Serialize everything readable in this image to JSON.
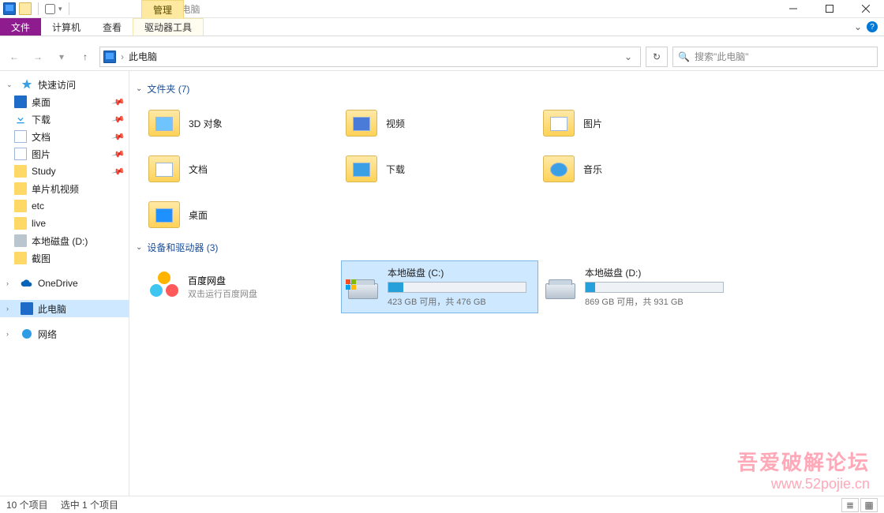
{
  "window": {
    "title": "此电脑"
  },
  "ribbon": {
    "file": "文件",
    "tabs": [
      "计算机",
      "查看"
    ],
    "context_header": "管理",
    "context_tool": "驱动器工具"
  },
  "nav": {
    "breadcrumb": "此电脑",
    "search_placeholder": "搜索\"此电脑\""
  },
  "sidebar": {
    "quick_access": "快速访问",
    "quick_items": [
      {
        "label": "桌面",
        "icon": "desktop",
        "pinned": true
      },
      {
        "label": "下载",
        "icon": "download",
        "pinned": true
      },
      {
        "label": "文档",
        "icon": "doc",
        "pinned": true
      },
      {
        "label": "图片",
        "icon": "pic",
        "pinned": true
      },
      {
        "label": "Study",
        "icon": "folder",
        "pinned": true
      },
      {
        "label": "单片机视频",
        "icon": "folder",
        "pinned": false
      },
      {
        "label": "etc",
        "icon": "folder",
        "pinned": false
      },
      {
        "label": "live",
        "icon": "folder",
        "pinned": false
      },
      {
        "label": "本地磁盘 (D:)",
        "icon": "drive",
        "pinned": false
      },
      {
        "label": "截图",
        "icon": "folder",
        "pinned": false
      }
    ],
    "onedrive": "OneDrive",
    "this_pc": "此电脑",
    "network": "网络"
  },
  "content": {
    "folders_header": "文件夹 (7)",
    "folders": [
      {
        "label": "3D 对象"
      },
      {
        "label": "视频"
      },
      {
        "label": "图片"
      },
      {
        "label": "文档"
      },
      {
        "label": "下载"
      },
      {
        "label": "音乐"
      },
      {
        "label": "桌面"
      }
    ],
    "drives_header": "设备和驱动器 (3)",
    "baidu": {
      "name": "百度网盘",
      "sub": "双击运行百度网盘"
    },
    "drives": [
      {
        "name": "本地磁盘 (C:)",
        "free": "423 GB 可用，共 476 GB",
        "used_pct": 11,
        "os": true,
        "selected": true
      },
      {
        "name": "本地磁盘 (D:)",
        "free": "869 GB 可用，共 931 GB",
        "used_pct": 7,
        "os": false,
        "selected": false
      }
    ]
  },
  "status": {
    "count": "10 个项目",
    "selected": "选中 1 个项目"
  },
  "watermark": {
    "cn": "吾爱破解论坛",
    "url": "www.52pojie.cn"
  }
}
